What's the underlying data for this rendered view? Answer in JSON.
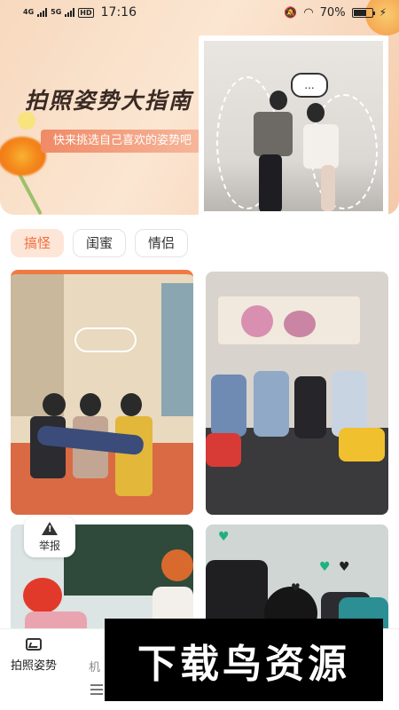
{
  "status_bar": {
    "network_1": "4G",
    "network_2": "5G",
    "hd": "HD",
    "time": "17:16",
    "battery": "70%",
    "battery_level": 0.7
  },
  "hero": {
    "title": "拍照姿势大指南",
    "subtitle": "快来挑选自己喜欢的姿势吧",
    "speech_bubble": "..."
  },
  "tabs": [
    {
      "label": "搞怪",
      "active": true
    },
    {
      "label": "闺蜜",
      "active": false
    },
    {
      "label": "情侣",
      "active": false
    }
  ],
  "report_button": {
    "label": "举报"
  },
  "bottom_nav": {
    "items": [
      {
        "label": "拍照姿势",
        "icon": "image-icon"
      },
      {
        "label": "机"
      }
    ]
  },
  "watermark": "下载鸟资源",
  "colors": {
    "accent": "#ee6e3c",
    "tab_active_bg": "#fde6d8",
    "hero_bg": "#f7d9be"
  }
}
